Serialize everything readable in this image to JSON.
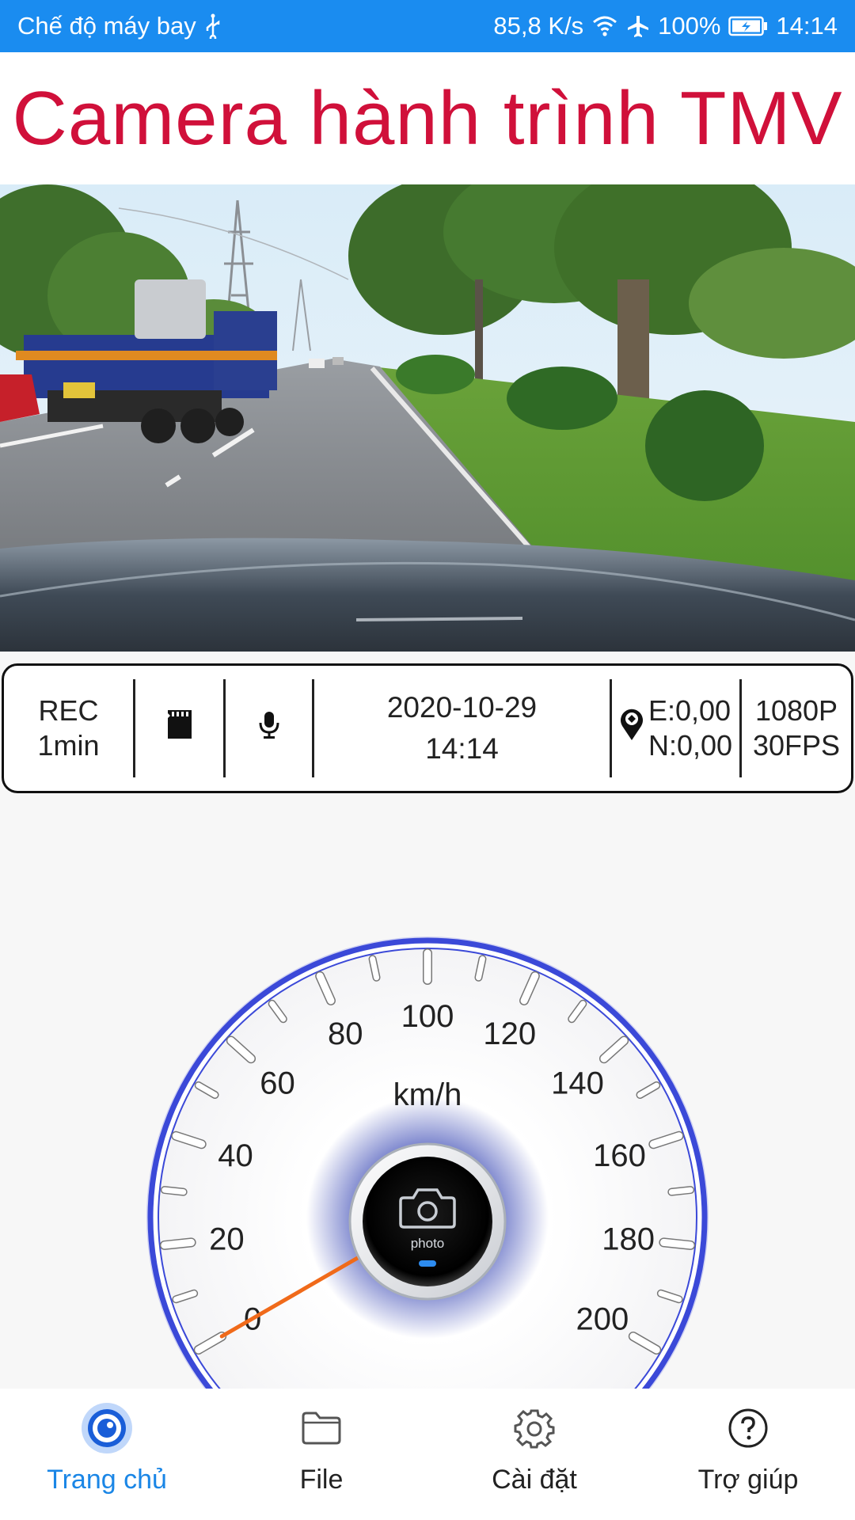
{
  "status_bar": {
    "mode": "Chế độ máy bay",
    "net_speed": "85,8 K/s",
    "battery": "100%",
    "time": "14:14"
  },
  "app": {
    "title": "Camera hành trình TMV"
  },
  "info_panel": {
    "rec_line1": "REC",
    "rec_line2": "1min",
    "date": "2020-10-29",
    "time": "14:14",
    "gps_e": "E:0,00",
    "gps_n": "N:0,00",
    "resolution": "1080P",
    "fps": "30FPS"
  },
  "speedometer": {
    "unit": "km/h",
    "ticks": [
      "0",
      "20",
      "40",
      "60",
      "80",
      "100",
      "120",
      "140",
      "160",
      "180",
      "200"
    ],
    "max": 200,
    "speed": 0,
    "center_button_label": "photo",
    "accent": "#3b49d8",
    "needle_color": "#f06a1a"
  },
  "nav": {
    "items": [
      {
        "label": "Trang chủ",
        "icon": "home-lens-icon",
        "active": true
      },
      {
        "label": "File",
        "icon": "folder-icon",
        "active": false
      },
      {
        "label": "Cài đặt",
        "icon": "gear-icon",
        "active": false
      },
      {
        "label": "Trợ giúp",
        "icon": "help-icon",
        "active": false
      }
    ]
  },
  "colors": {
    "status_bar": "#1a8cf0",
    "title": "#d0103a",
    "nav_active": "#1a86e6"
  }
}
